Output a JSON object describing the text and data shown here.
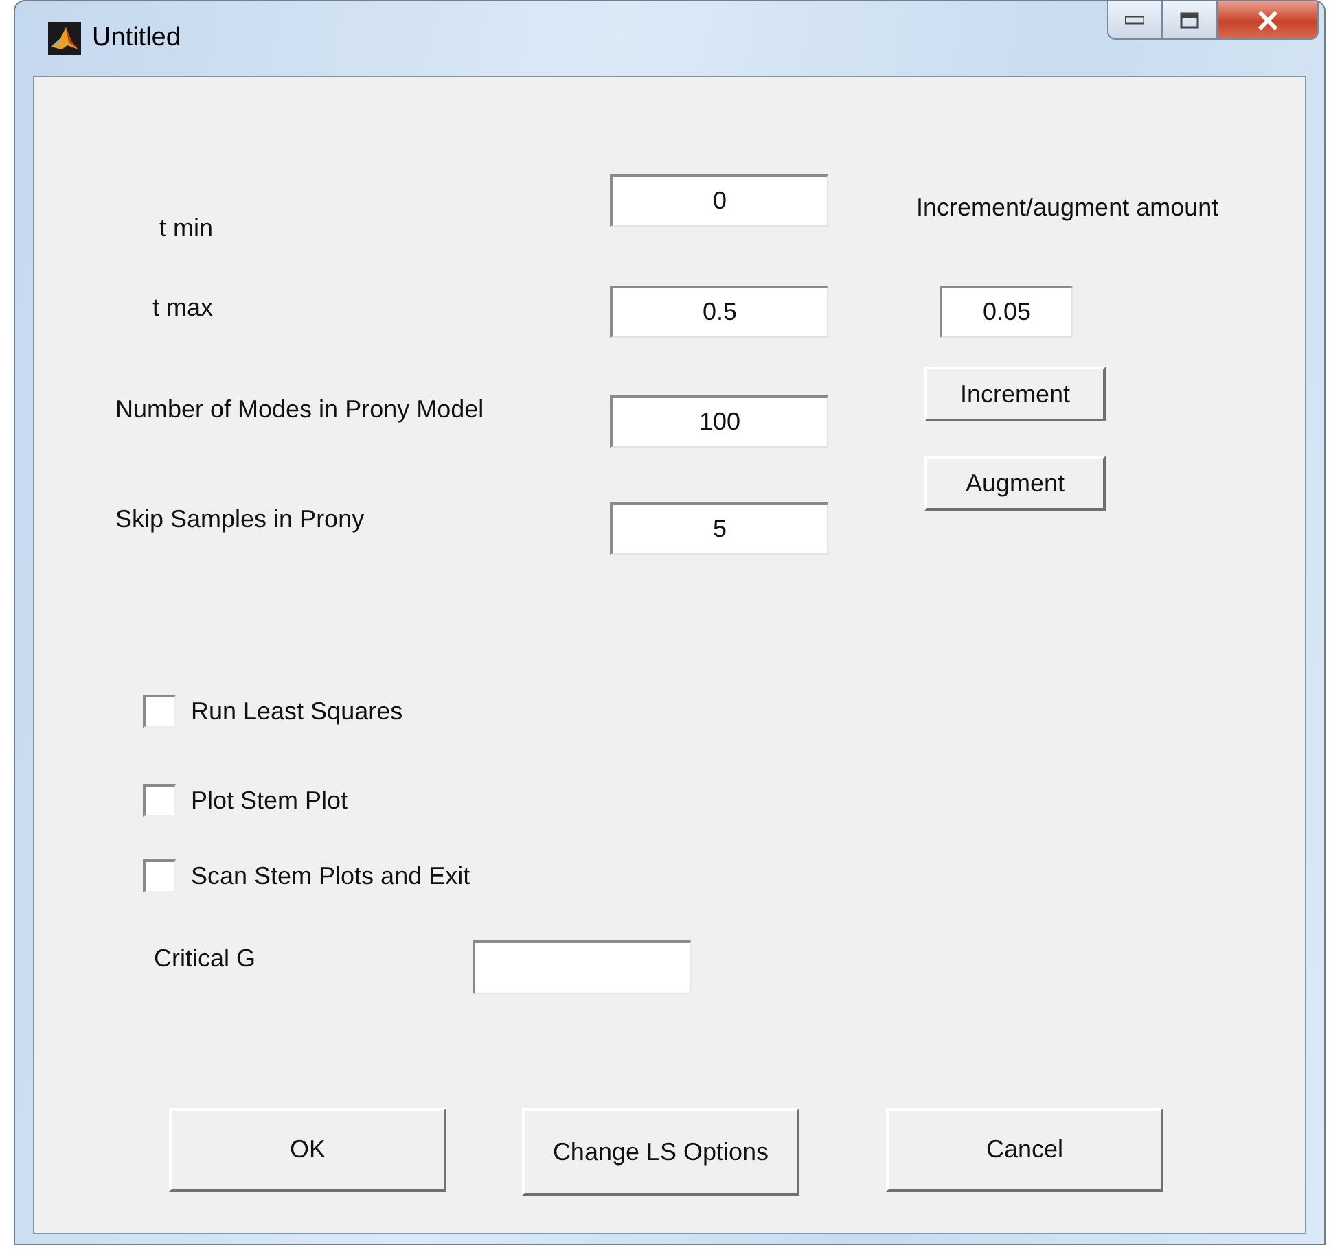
{
  "window": {
    "title": "Untitled"
  },
  "parameters": [
    {
      "label": "t min",
      "value": "0"
    },
    {
      "label": "t max",
      "value": "0.5"
    },
    {
      "label": "Number of Modes in Prony Model",
      "value": "100"
    },
    {
      "label": "Skip Samples in Prony",
      "value": "5"
    }
  ],
  "increment": {
    "label": "Increment/augment amount",
    "value": "0.05",
    "buttons": [
      "Increment",
      "Augment"
    ]
  },
  "options": [
    {
      "label": "Run Least Squares",
      "checked": false
    },
    {
      "label": "Plot Stem Plot",
      "checked": false
    },
    {
      "label": "Scan Stem Plots and Exit",
      "checked": false
    }
  ],
  "critical_g": {
    "label": "Critical G"
  },
  "buttons": [
    "OK",
    "Change LS Options",
    "Cancel"
  ]
}
